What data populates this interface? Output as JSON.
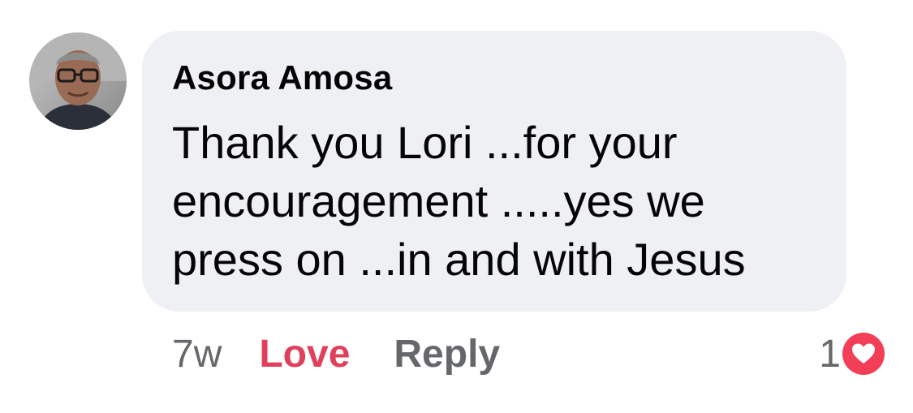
{
  "comment": {
    "author": "Asora Amosa",
    "text": "Thank you Lori ...for your\nencouragement .....yes we\npress on ...in and with Jesus"
  },
  "actions": {
    "time": "7w",
    "love_label": "Love",
    "reply_label": "Reply"
  },
  "reactions": {
    "count": "1",
    "icon": "heart-icon",
    "color": "#f33e58"
  },
  "colors": {
    "bubble": "#eff0f4",
    "love_accent": "#e0405b",
    "secondary_text": "#65676b"
  }
}
